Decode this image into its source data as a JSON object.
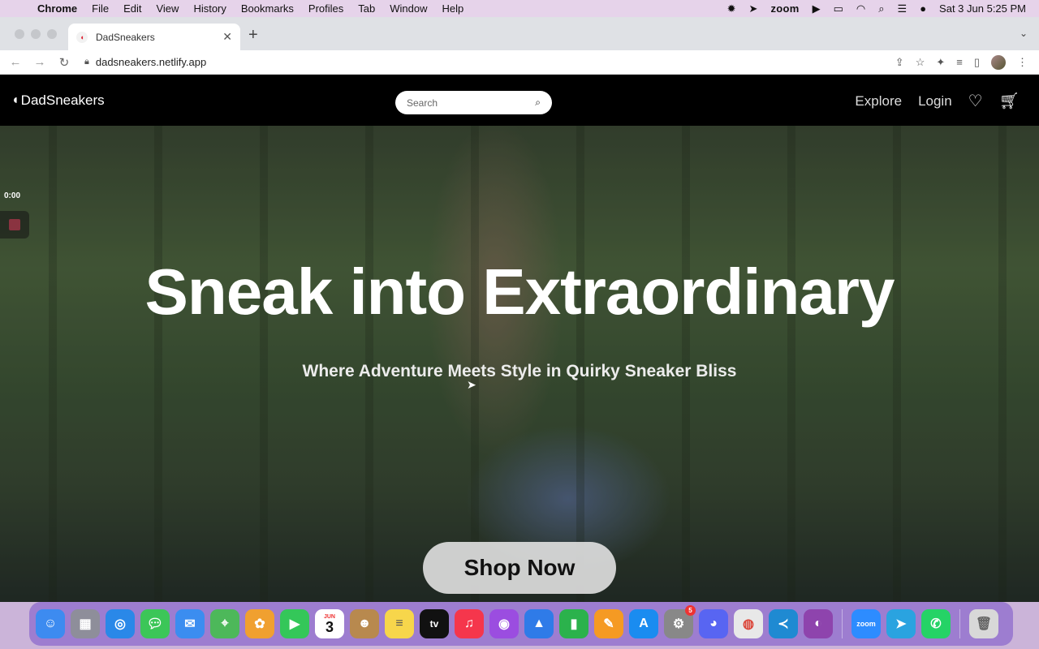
{
  "menubar": {
    "app_name": "Chrome",
    "items": [
      "File",
      "Edit",
      "View",
      "History",
      "Bookmarks",
      "Profiles",
      "Tab",
      "Window",
      "Help"
    ],
    "zoom_label": "zoom",
    "clock": "Sat 3 Jun  5:25 PM"
  },
  "browser": {
    "tab_title": "DadSneakers",
    "url": "dadsneakers.netlify.app"
  },
  "site": {
    "logo": "DadSneakers",
    "search_placeholder": "Search",
    "nav": {
      "explore": "Explore",
      "login": "Login"
    },
    "recording_time": "0:00",
    "hero_title": "Sneak into Extraordinary",
    "hero_subtitle": "Where Adventure Meets Style in Quirky Sneaker Bliss",
    "cta": "Shop Now"
  },
  "dock": {
    "calendar_month": "JUN",
    "calendar_day": "3",
    "tv_label": "tv",
    "settings_badge": "5",
    "zoom_label": "zoom",
    "apps": [
      {
        "name": "finder",
        "color": "#3d8bf0"
      },
      {
        "name": "launchpad",
        "color": "#8e8e9a"
      },
      {
        "name": "safari",
        "color": "#2a88e8"
      },
      {
        "name": "messages",
        "color": "#3cc658"
      },
      {
        "name": "mail",
        "color": "#3b8df0"
      },
      {
        "name": "maps",
        "color": "#4db85a"
      },
      {
        "name": "photos",
        "color": "#f0a030"
      },
      {
        "name": "facetime",
        "color": "#34c759"
      },
      {
        "name": "calendar",
        "color": "#ffffff"
      },
      {
        "name": "contacts",
        "color": "#b8894e"
      },
      {
        "name": "notes",
        "color": "#f7d64b"
      },
      {
        "name": "apple-tv",
        "color": "#111111"
      },
      {
        "name": "music",
        "color": "#f5364c"
      },
      {
        "name": "podcasts",
        "color": "#9b4de0"
      },
      {
        "name": "keynote",
        "color": "#2f7be8"
      },
      {
        "name": "numbers",
        "color": "#2bb24c"
      },
      {
        "name": "pages",
        "color": "#f59a23"
      },
      {
        "name": "app-store",
        "color": "#1a8cf0"
      },
      {
        "name": "system-settings",
        "color": "#888888"
      },
      {
        "name": "discord",
        "color": "#5865f2"
      },
      {
        "name": "chrome",
        "color": "#e8e8e8"
      },
      {
        "name": "vscode",
        "color": "#1f8ad2"
      },
      {
        "name": "github-desktop",
        "color": "#8e44ad"
      },
      {
        "name": "zoom",
        "color": "#2d8cff"
      },
      {
        "name": "telegram",
        "color": "#2aa3e0"
      },
      {
        "name": "whatsapp",
        "color": "#25d366"
      },
      {
        "name": "trash",
        "color": "#d8d8d8"
      }
    ]
  }
}
